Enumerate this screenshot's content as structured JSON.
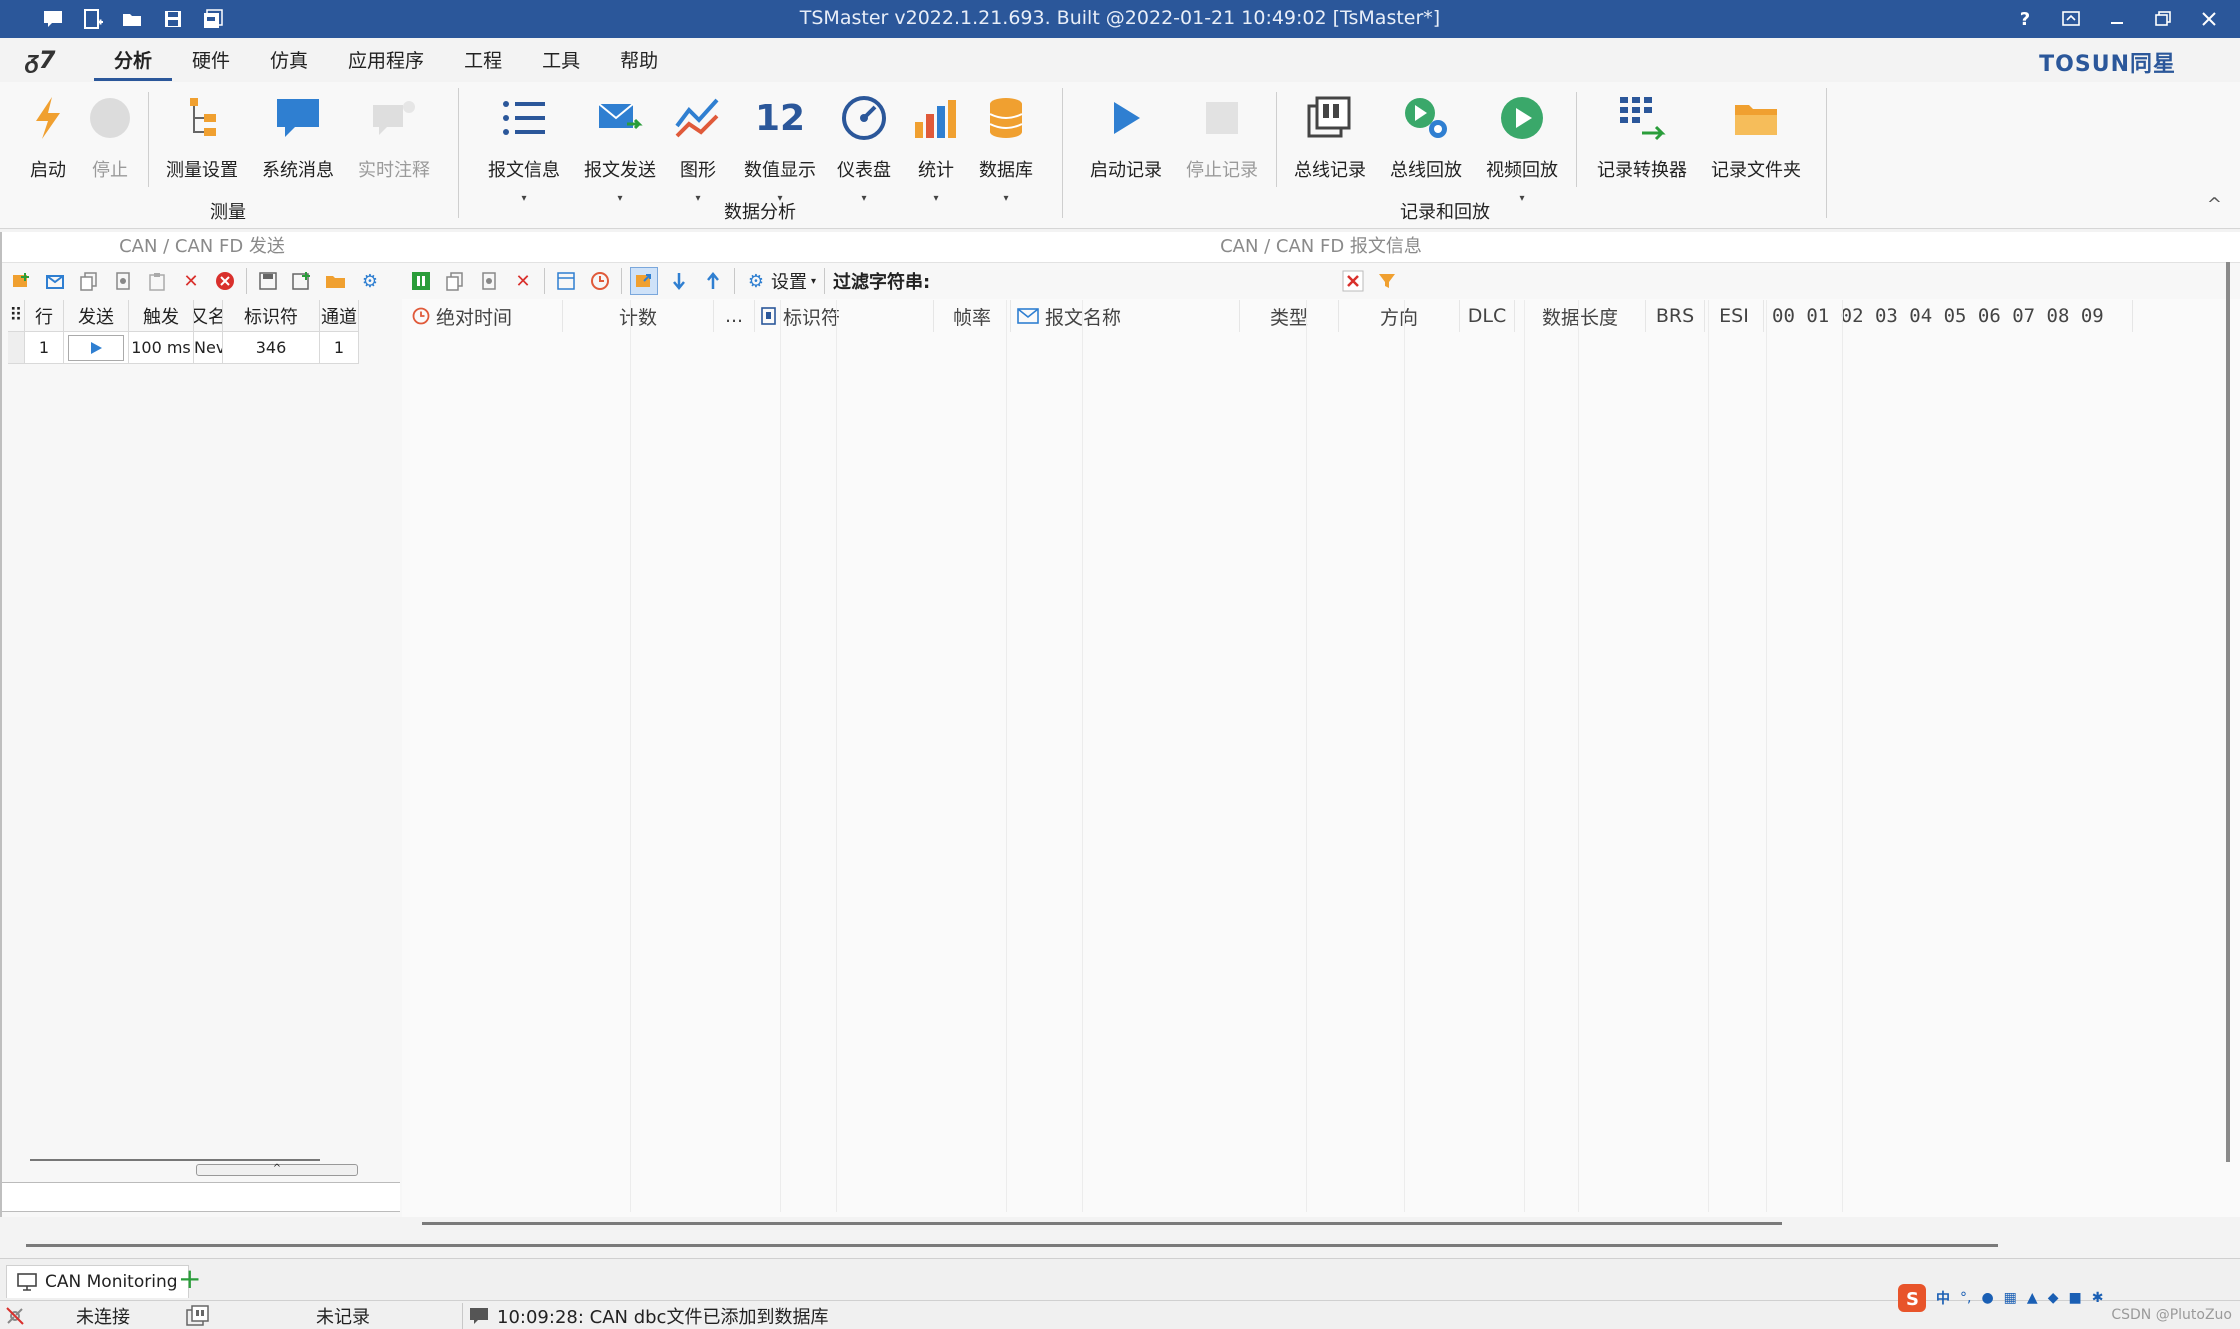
{
  "titlebar": {
    "title": "TSMaster v2022.1.21.693. Built @2022-01-21 10:49:02 [TsMaster*]",
    "help": "?",
    "quick_icons": [
      "chat-icon",
      "new-file-icon",
      "open-folder-icon",
      "save-icon",
      "save-all-icon"
    ]
  },
  "menu": {
    "logo": "ᵹ7",
    "items": [
      "分析",
      "硬件",
      "仿真",
      "应用程序",
      "工程",
      "工具",
      "帮助"
    ],
    "active": "分析",
    "brand": "TOSUN同星"
  },
  "ribbon": {
    "measure": {
      "group": "测量",
      "start": "启动",
      "stop": "停止",
      "settings": "测量设置",
      "sysmsg": "系统消息",
      "realtime_note": "实时注释"
    },
    "analysis": {
      "group": "数据分析",
      "msg_info": "报文信息",
      "msg_send": "报文发送",
      "graph": "图形",
      "value_display": "数值显示",
      "value_icon_text": "12",
      "dashboard": "仪表盘",
      "stats": "统计",
      "database": "数据库"
    },
    "record": {
      "group": "记录和回放",
      "start_rec": "启动记录",
      "stop_rec": "停止记录",
      "bus_rec": "总线记录",
      "bus_replay": "总线回放",
      "video_replay": "视频回放",
      "rec_converter": "记录转换器",
      "rec_folder": "记录文件夹"
    }
  },
  "left_panel": {
    "title": "CAN / CAN FD 发送",
    "columns": [
      "⠿",
      "行",
      "发送",
      "触发",
      "又名",
      "标识符",
      "通道"
    ],
    "rows": [
      {
        "row": "1",
        "trigger": "100 ms",
        "name": "Nev",
        "id": "346",
        "channel": "1"
      }
    ]
  },
  "right_panel": {
    "title": "CAN / CAN FD 报文信息",
    "settings_label": "设置",
    "filter_label": "过滤字符串:",
    "filter_value": "",
    "columns": {
      "abs_time": "绝对时间",
      "count": "计数",
      "more": "...",
      "identifier": "标识符",
      "frame_rate": "帧率",
      "msg_name": "报文名称",
      "type": "类型",
      "direction": "方向",
      "dlc": "DLC",
      "data_len": "数据长度",
      "brs": "BRS",
      "esi": "ESI",
      "bytes": "00 01 02 03 04 05 06 07 08 09"
    }
  },
  "tabs": {
    "can_monitoring": "CAN Monitoring",
    "add": "+"
  },
  "status": {
    "connection": "未连接",
    "recording": "未记录",
    "message": "10:09:28: CAN dbc文件已添加到数据库",
    "watermark": "CSDN @PlutoZuo"
  },
  "ime": {
    "lang": "中"
  },
  "colors": {
    "titlebar": "#2b579a",
    "accent_blue": "#2f7fd1",
    "orange": "#f0a030",
    "green": "#2a9d3a",
    "red": "#d9302c"
  }
}
